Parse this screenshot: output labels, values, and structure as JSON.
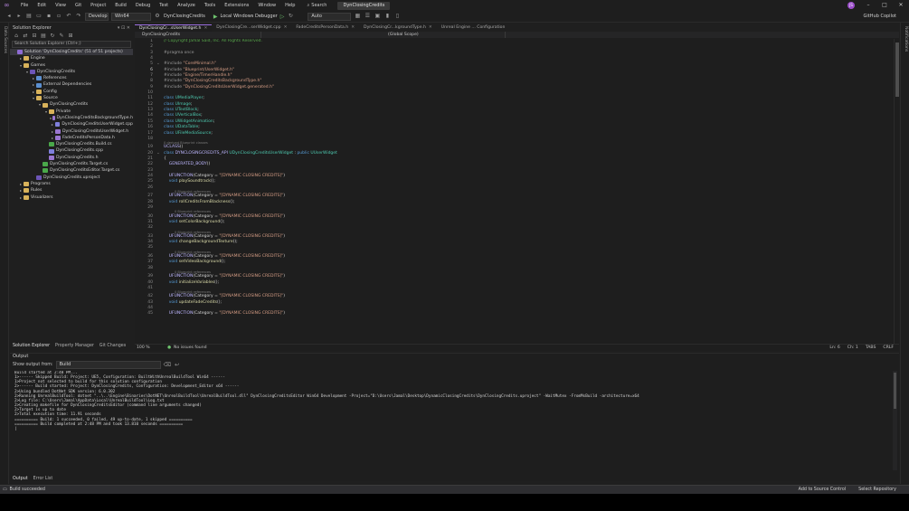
{
  "app": {
    "logo_label": "VS",
    "solution_title": "DynClosingCredits",
    "search_label": "Search",
    "avatar_initials": "JS",
    "copilot_label": "GitHub Copilot"
  },
  "menu": [
    "File",
    "Edit",
    "View",
    "Git",
    "Project",
    "Build",
    "Debug",
    "Test",
    "Analyze",
    "Tools",
    "Extensions",
    "Window",
    "Help"
  ],
  "toolbar": {
    "config": "Develop",
    "platform": "Win64",
    "startup_project": "DynClosingCredits",
    "debugger": "Local Windows Debugger",
    "solution_config": "Auto"
  },
  "solution_explorer": {
    "title": "Solution Explorer",
    "search_placeholder": "Search Solution Explorer (Ctrl+;)",
    "rows": [
      {
        "label": "Solution 'DynClosingCredits' (51 of 51 projects)",
        "indent": 0,
        "icon": "sln",
        "arrow": ""
      },
      {
        "label": "Engine",
        "indent": 1,
        "icon": "folder",
        "arrow": "▸"
      },
      {
        "label": "Games",
        "indent": 1,
        "icon": "folder",
        "arrow": "▾"
      },
      {
        "label": "DynClosingCredits",
        "indent": 2,
        "icon": "proj",
        "arrow": "▾"
      },
      {
        "label": "References",
        "indent": 3,
        "icon": "ref",
        "arrow": "▸"
      },
      {
        "label": "External Dependencies",
        "indent": 3,
        "icon": "ref",
        "arrow": "▸"
      },
      {
        "label": "Config",
        "indent": 3,
        "icon": "folder",
        "arrow": "▸"
      },
      {
        "label": "Source",
        "indent": 3,
        "icon": "folder",
        "arrow": "▾"
      },
      {
        "label": "DynClosingCredits",
        "indent": 4,
        "icon": "folder",
        "arrow": "▾"
      },
      {
        "label": "Private",
        "indent": 5,
        "icon": "folder",
        "arrow": "▾"
      },
      {
        "label": "DynClosingCreditsBackgroundType.h",
        "indent": 6,
        "icon": "hdr",
        "arrow": "▸"
      },
      {
        "label": "DynClosingCreditsUserWidget.cpp",
        "indent": 6,
        "icon": "cpp",
        "arrow": "▸"
      },
      {
        "label": "DynClosingCreditsUserWidget.h",
        "indent": 6,
        "icon": "hdr",
        "arrow": "▸"
      },
      {
        "label": "FadeCreditsPersonData.h",
        "indent": 6,
        "icon": "hdr",
        "arrow": "▸"
      },
      {
        "label": "DynClosingCredits.Build.cs",
        "indent": 5,
        "icon": "cs",
        "arrow": ""
      },
      {
        "label": "DynClosingCredits.cpp",
        "indent": 5,
        "icon": "cpp",
        "arrow": ""
      },
      {
        "label": "DynClosingCredits.h",
        "indent": 5,
        "icon": "hdr",
        "arrow": ""
      },
      {
        "label": "DynClosingCredits.Target.cs",
        "indent": 4,
        "icon": "cs",
        "arrow": ""
      },
      {
        "label": "DynClosingCreditsEditor.Target.cs",
        "indent": 4,
        "icon": "cs",
        "arrow": ""
      },
      {
        "label": "DynClosingCredits.uproject",
        "indent": 3,
        "icon": "proj",
        "arrow": ""
      },
      {
        "label": "Programs",
        "indent": 1,
        "icon": "folder",
        "arrow": "▸"
      },
      {
        "label": "Rules",
        "indent": 1,
        "icon": "folder",
        "arrow": "▸"
      },
      {
        "label": "Visualizers",
        "indent": 1,
        "icon": "folder",
        "arrow": "▸"
      }
    ],
    "bottom_tabs": [
      "Solution Explorer",
      "Property Manager",
      "Git Changes"
    ]
  },
  "editor": {
    "tabs": [
      "DynClosingCr...sUserWidget.h",
      "DynClosingCre...serWidget.cpp",
      "FadeCreditsPersonData.h",
      "DynClosingCr...kgroundType.h",
      "Unreal Engine ... Configuration"
    ],
    "nav": [
      "DynClosingCredits",
      "(Global Scope)"
    ],
    "hint_blueprint_refs": "0 Blueprint references",
    "hint_derived": "0 derived Blueprint classes",
    "lines": [
      {
        "n": "1",
        "segs": [
          [
            "comment",
            "// Copyright Jamal Said, Inc. All Rights Reserved."
          ]
        ]
      },
      {
        "n": "2",
        "segs": []
      },
      {
        "n": "3",
        "segs": [
          [
            "pp",
            "#pragma once"
          ]
        ]
      },
      {
        "n": "4",
        "segs": []
      },
      {
        "n": "5",
        "segs": [
          [
            "pp",
            "#include "
          ],
          [
            "str",
            "\"CoreMinimal.h\""
          ]
        ]
      },
      {
        "n": "6",
        "segs": [
          [
            "pp",
            "#include "
          ],
          [
            "str",
            "\"Blueprint/UserWidget.h\""
          ]
        ]
      },
      {
        "n": "7",
        "segs": [
          [
            "pp",
            "#include "
          ],
          [
            "str",
            "\"Engine/TimerHandle.h\""
          ]
        ]
      },
      {
        "n": "8",
        "segs": [
          [
            "pp",
            "#include "
          ],
          [
            "str",
            "\"DynClosingCreditsBackgroundType.h\""
          ]
        ]
      },
      {
        "n": "9",
        "segs": [
          [
            "pp",
            "#include "
          ],
          [
            "str",
            "\"DynClosingCreditsUserWidget.generated.h\""
          ]
        ]
      },
      {
        "n": "10",
        "segs": []
      },
      {
        "n": "11",
        "segs": [
          [
            "kw",
            "class "
          ],
          [
            "type",
            "UMediaPlayer"
          ],
          [
            "ct",
            ";"
          ]
        ]
      },
      {
        "n": "12",
        "segs": [
          [
            "kw",
            "class "
          ],
          [
            "type",
            "UImage"
          ],
          [
            "ct",
            ";"
          ]
        ]
      },
      {
        "n": "13",
        "segs": [
          [
            "kw",
            "class "
          ],
          [
            "type",
            "UTextBlock"
          ],
          [
            "ct",
            ";"
          ]
        ]
      },
      {
        "n": "14",
        "segs": [
          [
            "kw",
            "class "
          ],
          [
            "type",
            "UVerticalBox"
          ],
          [
            "ct",
            ";"
          ]
        ]
      },
      {
        "n": "15",
        "segs": [
          [
            "kw",
            "class "
          ],
          [
            "type",
            "UWidgetAnimation"
          ],
          [
            "ct",
            ";"
          ]
        ]
      },
      {
        "n": "16",
        "segs": [
          [
            "kw",
            "class "
          ],
          [
            "type",
            "UDataTable"
          ],
          [
            "ct",
            ";"
          ]
        ]
      },
      {
        "n": "17",
        "segs": [
          [
            "kw",
            "class "
          ],
          [
            "type",
            "UFileMediaSource"
          ],
          [
            "ct",
            ";"
          ]
        ]
      },
      {
        "n": "18",
        "segs": []
      },
      {
        "n": "19",
        "segs": [
          [
            "macro",
            "UCLASS"
          ],
          [
            "ct",
            "()"
          ]
        ],
        "hint": "derived"
      },
      {
        "n": "20",
        "segs": [
          [
            "kw",
            "class "
          ],
          [
            "macro",
            "DYNCLOSINGCREDITS_API "
          ],
          [
            "type",
            "UDynClosingCreditsUserWidget"
          ],
          [
            "ct",
            " : "
          ],
          [
            "kw",
            "public "
          ],
          [
            "type",
            "UUserWidget"
          ]
        ]
      },
      {
        "n": "21",
        "segs": [
          [
            "ct",
            "{"
          ]
        ]
      },
      {
        "n": "22",
        "segs": [
          [
            "ct",
            "    "
          ],
          [
            "macro",
            "GENERATED_BODY"
          ],
          [
            "ct",
            "()"
          ]
        ]
      },
      {
        "n": "23",
        "segs": []
      },
      {
        "n": "24",
        "segs": [
          [
            "ct",
            "    "
          ],
          [
            "macro",
            "UFUNCTION"
          ],
          [
            "ct",
            "(Category = "
          ],
          [
            "str",
            "\"[DYNAMIC CLOSING CREDITS]\""
          ],
          [
            "ct",
            ")"
          ]
        ]
      },
      {
        "n": "25",
        "segs": [
          [
            "ct",
            "    "
          ],
          [
            "kw",
            "void "
          ],
          [
            "fn",
            "playSoundtrack"
          ],
          [
            "ct",
            "();"
          ]
        ]
      },
      {
        "n": "26",
        "segs": []
      },
      {
        "n": "27",
        "segs": [
          [
            "ct",
            "    "
          ],
          [
            "macro",
            "UFUNCTION"
          ],
          [
            "ct",
            "(Category = "
          ],
          [
            "str",
            "\"[DYNAMIC CLOSING CREDITS]\""
          ],
          [
            "ct",
            ")"
          ]
        ],
        "hint": "refs"
      },
      {
        "n": "28",
        "segs": [
          [
            "ct",
            "    "
          ],
          [
            "kw",
            "void "
          ],
          [
            "fn",
            "rollCreditsFromBlackness"
          ],
          [
            "ct",
            "();"
          ]
        ]
      },
      {
        "n": "29",
        "segs": []
      },
      {
        "n": "30",
        "segs": [
          [
            "ct",
            "    "
          ],
          [
            "macro",
            "UFUNCTION"
          ],
          [
            "ct",
            "(Category = "
          ],
          [
            "str",
            "\"[DYNAMIC CLOSING CREDITS]\""
          ],
          [
            "ct",
            ")"
          ]
        ],
        "hint": "refs"
      },
      {
        "n": "31",
        "segs": [
          [
            "ct",
            "    "
          ],
          [
            "kw",
            "void "
          ],
          [
            "fn",
            "setColorBackground"
          ],
          [
            "ct",
            "();"
          ]
        ]
      },
      {
        "n": "32",
        "segs": []
      },
      {
        "n": "33",
        "segs": [
          [
            "ct",
            "    "
          ],
          [
            "macro",
            "UFUNCTION"
          ],
          [
            "ct",
            "(Category = "
          ],
          [
            "str",
            "\"[DYNAMIC CLOSING CREDITS]\""
          ],
          [
            "ct",
            ")"
          ]
        ],
        "hint": "refs"
      },
      {
        "n": "34",
        "segs": [
          [
            "ct",
            "    "
          ],
          [
            "kw",
            "void "
          ],
          [
            "fn",
            "changeBackgroundTexture"
          ],
          [
            "ct",
            "();"
          ]
        ]
      },
      {
        "n": "35",
        "segs": []
      },
      {
        "n": "36",
        "segs": [
          [
            "ct",
            "    "
          ],
          [
            "macro",
            "UFUNCTION"
          ],
          [
            "ct",
            "(Category = "
          ],
          [
            "str",
            "\"[DYNAMIC CLOSING CREDITS]\""
          ],
          [
            "ct",
            ")"
          ]
        ],
        "hint": "refs"
      },
      {
        "n": "37",
        "segs": [
          [
            "ct",
            "    "
          ],
          [
            "kw",
            "void "
          ],
          [
            "fn",
            "setVideoBackground"
          ],
          [
            "ct",
            "();"
          ]
        ]
      },
      {
        "n": "38",
        "segs": []
      },
      {
        "n": "39",
        "segs": [
          [
            "ct",
            "    "
          ],
          [
            "macro",
            "UFUNCTION"
          ],
          [
            "ct",
            "(Category = "
          ],
          [
            "str",
            "\"[DYNAMIC CLOSING CREDITS]\""
          ],
          [
            "ct",
            ")"
          ]
        ],
        "hint": "refs"
      },
      {
        "n": "40",
        "segs": [
          [
            "ct",
            "    "
          ],
          [
            "kw",
            "void "
          ],
          [
            "fn",
            "initializeVariables"
          ],
          [
            "ct",
            "();"
          ]
        ]
      },
      {
        "n": "41",
        "segs": []
      },
      {
        "n": "42",
        "segs": [
          [
            "ct",
            "    "
          ],
          [
            "macro",
            "UFUNCTION"
          ],
          [
            "ct",
            "(Category = "
          ],
          [
            "str",
            "\"[DYNAMIC CLOSING CREDITS]\""
          ],
          [
            "ct",
            ")"
          ]
        ],
        "hint": "refs"
      },
      {
        "n": "43",
        "segs": [
          [
            "ct",
            "    "
          ],
          [
            "kw",
            "void "
          ],
          [
            "fn",
            "updateFadeCredits"
          ],
          [
            "ct",
            "();"
          ]
        ]
      },
      {
        "n": "44",
        "segs": []
      },
      {
        "n": "45",
        "segs": [
          [
            "ct",
            "    "
          ],
          [
            "macro",
            "UFUNCTION"
          ],
          [
            "ct",
            "(Category = "
          ],
          [
            "str",
            "\"[DYNAMIC CLOSING CREDITS]\""
          ],
          [
            "ct",
            ")"
          ]
        ]
      }
    ],
    "zoom": "100 %",
    "issues": "No issues found",
    "ln": "Ln: 6",
    "ch": "Ch: 1",
    "tabs_mode": "TABS",
    "eol": "CRLF"
  },
  "output": {
    "title": "Output",
    "show_from_label": "Show output from:",
    "show_from_value": "Build",
    "lines": [
      "Build started at 2:48 PM...",
      "1>------ Skipped Build: Project: UE5, Configuration: BuiltWithUnrealBuildTool Win64 ------",
      "1>Project not selected to build for this solution configuration",
      "2>------ Build started: Project: DynClosingCredits, Configuration: Development_Editor x64 ------",
      "2>Using bundled DotNet SDK version: 6.0.302",
      "2>Running UnrealBuildTool: dotnet \"..\\..\\Engine\\Binaries\\DotNET\\UnrealBuildTool\\UnrealBuildTool.dll\" DynClosingCreditsEditor Win64 Development -Project=\"D:\\Users\\Jamal\\Desktop\\DynamicClosingCredits\\DynClosingCredits.uproject\" -WaitMutex -FromMsBuild -architecture=x64",
      "2>Log file: C:\\Users\\Jamal\\AppData\\Local\\UnrealBuildTool\\Log.txt",
      "2>Creating makefile for DynClosingCreditsEditor (command line arguments changed)",
      "2>Target is up to date",
      "2>Total execution time: 11.91 seconds",
      "========== Build: 1 succeeded, 0 failed, 49 up-to-date, 1 skipped ==========",
      "========== Build completed at 2:48 PM and took 13.810 seconds =========="
    ],
    "tabs": [
      "Output",
      "Error List"
    ]
  },
  "statusbar": {
    "left": "Build succeeded",
    "add_source": "Add to Source Control",
    "select_repo": "Select Repository"
  },
  "side_labels": {
    "left": "Data Sources",
    "right": "Notifications"
  }
}
